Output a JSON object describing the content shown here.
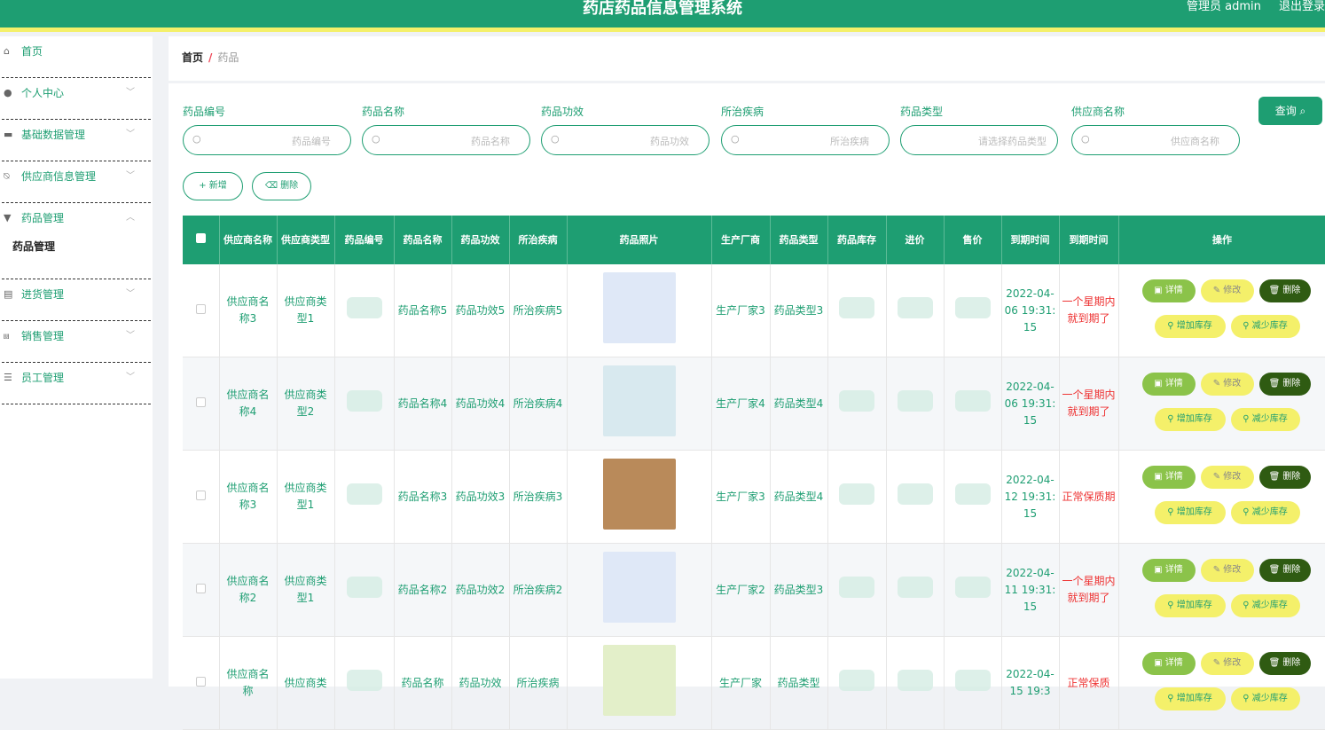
{
  "header": {
    "title": "药店药品信息管理系统",
    "user": "管理员 admin",
    "logout": "退出登录"
  },
  "sidebar": {
    "items": [
      {
        "icon": "home-icon",
        "label": "首页"
      },
      {
        "icon": "user-icon",
        "label": "个人中心"
      },
      {
        "icon": "monitor-icon",
        "label": "基础数据管理"
      },
      {
        "icon": "bell-off-icon",
        "label": "供应商信息管理"
      },
      {
        "icon": "pill-icon",
        "label": "药品管理"
      },
      {
        "icon": "",
        "label": "药品管理"
      },
      {
        "icon": "document-icon",
        "label": "进货管理"
      },
      {
        "icon": "cart-icon",
        "label": "销售管理"
      },
      {
        "icon": "list-icon",
        "label": "员工管理"
      }
    ]
  },
  "breadcrumb": {
    "home": "首页",
    "sep": "/",
    "current": "药品"
  },
  "filters": [
    {
      "label": "药品编号",
      "placeholder": "药品编号"
    },
    {
      "label": "药品名称",
      "placeholder": "药品名称"
    },
    {
      "label": "药品功效",
      "placeholder": "药品功效"
    },
    {
      "label": "所治疾病",
      "placeholder": "所治疾病"
    },
    {
      "label": "药品类型",
      "placeholder": "请选择药品类型"
    },
    {
      "label": "供应商名称",
      "placeholder": "供应商名称"
    }
  ],
  "buttons": {
    "query": "查询 ⌕",
    "add": "+ 新增",
    "delete": "⌫ 删除"
  },
  "table": {
    "headers": [
      "供应商名称",
      "供应商类型",
      "药品编号",
      "药品名称",
      "药品功效",
      "所治疾病",
      "药品照片",
      "生产厂商",
      "药品类型",
      "药品库存",
      "进价",
      "售价",
      "到期时间",
      "到期时间",
      "操作"
    ],
    "rows": [
      {
        "supplier": "供应商名称3",
        "stype": "供应商类型1",
        "name": "药品名称5",
        "effect": "药品功效5",
        "disease": "所治疾病5",
        "maker": "生产厂家3",
        "dtype": "药品类型3",
        "expire": "2022-04-06 19:31:15",
        "status": "一个星期内就到期了",
        "photo": "#dfe8f7"
      },
      {
        "supplier": "供应商名称4",
        "stype": "供应商类型2",
        "name": "药品名称4",
        "effect": "药品功效4",
        "disease": "所治疾病4",
        "maker": "生产厂家4",
        "dtype": "药品类型4",
        "expire": "2022-04-06 19:31:15",
        "status": "一个星期内就到期了",
        "photo": "#d8e9ef"
      },
      {
        "supplier": "供应商名称3",
        "stype": "供应商类型1",
        "name": "药品名称3",
        "effect": "药品功效3",
        "disease": "所治疾病3",
        "maker": "生产厂家3",
        "dtype": "药品类型4",
        "expire": "2022-04-12 19:31:15",
        "status": "正常保质期",
        "photo": "#b98a5a"
      },
      {
        "supplier": "供应商名称2",
        "stype": "供应商类型1",
        "name": "药品名称2",
        "effect": "药品功效2",
        "disease": "所治疾病2",
        "maker": "生产厂家2",
        "dtype": "药品类型3",
        "expire": "2022-04-11 19:31:15",
        "status": "一个星期内就到期了",
        "photo": "#dfe8f7"
      },
      {
        "supplier": "供应商名称",
        "stype": "供应商类",
        "name": "药品名称",
        "effect": "药品功效",
        "disease": "所治疾病",
        "maker": "生产厂家",
        "dtype": "药品类型",
        "expire": "2022-04-15 19:3",
        "status": "正常保质",
        "photo": "#e3efc9"
      }
    ],
    "actions": {
      "detail": "▣ 详情",
      "edit": "✎ 修改",
      "delete": "🗑 删除",
      "add_stock": "⚲ 增加库存",
      "reduce_stock": "⚲ 减少库存"
    }
  }
}
